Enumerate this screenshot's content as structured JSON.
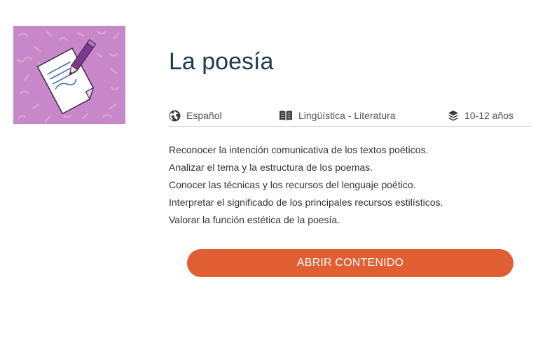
{
  "resource": {
    "title": "La poesía",
    "thumbnail_icon": "poem-paper-pencil-icon",
    "thumbnail_background": "#c887c8"
  },
  "meta": {
    "language": "Español",
    "language_icon": "globe-icon",
    "subject": "Lingüística - Literatura",
    "subject_icon": "open-book-icon",
    "age": "10-12 años",
    "age_icon": "layers-icon"
  },
  "objectives": [
    "Reconocer la intención comunicativa de los textos poéticos.",
    "Analizar el tema y la estructura de los poemas.",
    "Conocer las técnicas y los recursos del lenguaje poético.",
    "Interpretar el significado de los principales recursos estilísticos.",
    "Valorar la función estética de la poesía."
  ],
  "actions": {
    "open_label": "ABRIR CONTENIDO",
    "accent_color": "#e15d32"
  },
  "colors": {
    "title": "#1f3a4b",
    "text": "#333333"
  }
}
